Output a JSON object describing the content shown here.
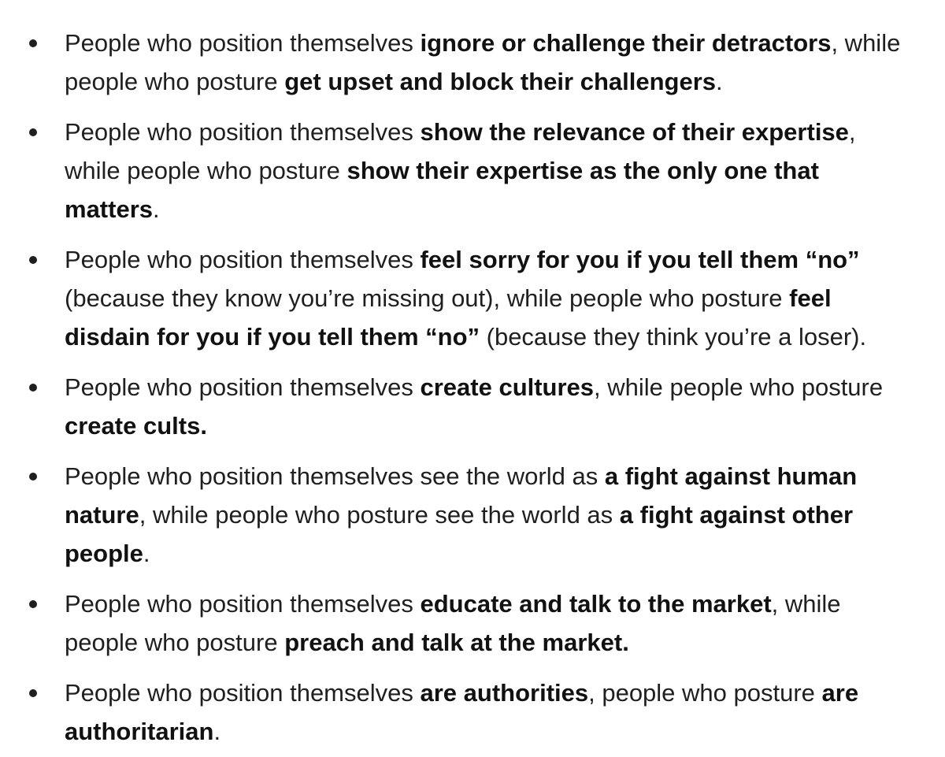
{
  "bullets": [
    {
      "segments": [
        {
          "text": "People who position themselves ",
          "bold": false
        },
        {
          "text": "ignore or challenge their detractors",
          "bold": true
        },
        {
          "text": ", while people who posture ",
          "bold": false
        },
        {
          "text": "get upset and block their challengers",
          "bold": true
        },
        {
          "text": ".",
          "bold": false
        }
      ]
    },
    {
      "segments": [
        {
          "text": "People who position themselves ",
          "bold": false
        },
        {
          "text": "show the relevance of their expertise",
          "bold": true
        },
        {
          "text": ", while people who posture ",
          "bold": false
        },
        {
          "text": "show their expertise as the only one that matters",
          "bold": true
        },
        {
          "text": ".",
          "bold": false
        }
      ]
    },
    {
      "segments": [
        {
          "text": "People who position themselves ",
          "bold": false
        },
        {
          "text": "feel sorry for you if you tell them “no”",
          "bold": true
        },
        {
          "text": "  (because they know you’re missing out), while people who posture ",
          "bold": false
        },
        {
          "text": "feel disdain for you if you tell them “no”",
          "bold": true
        },
        {
          "text": " (because they think you’re a loser).",
          "bold": false
        }
      ]
    },
    {
      "segments": [
        {
          "text": "People who position themselves ",
          "bold": false
        },
        {
          "text": "create cultures",
          "bold": true
        },
        {
          "text": ", while people who posture ",
          "bold": false
        },
        {
          "text": "create cults.",
          "bold": true
        }
      ]
    },
    {
      "segments": [
        {
          "text": "People who position themselves see the world as ",
          "bold": false
        },
        {
          "text": "a fight against human nature",
          "bold": true
        },
        {
          "text": ", while people who posture see the world as ",
          "bold": false
        },
        {
          "text": "a fight against other people",
          "bold": true
        },
        {
          "text": ".",
          "bold": false
        }
      ]
    },
    {
      "segments": [
        {
          "text": "People who position themselves ",
          "bold": false
        },
        {
          "text": "educate and talk to the market",
          "bold": true
        },
        {
          "text": ", while people who posture ",
          "bold": false
        },
        {
          "text": "preach and talk at the market.",
          "bold": true
        }
      ]
    },
    {
      "segments": [
        {
          "text": "People who position themselves ",
          "bold": false
        },
        {
          "text": "are authorities",
          "bold": true
        },
        {
          "text": ", people who posture ",
          "bold": false
        },
        {
          "text": "are authoritarian",
          "bold": true
        },
        {
          "text": ".",
          "bold": false
        }
      ]
    }
  ]
}
